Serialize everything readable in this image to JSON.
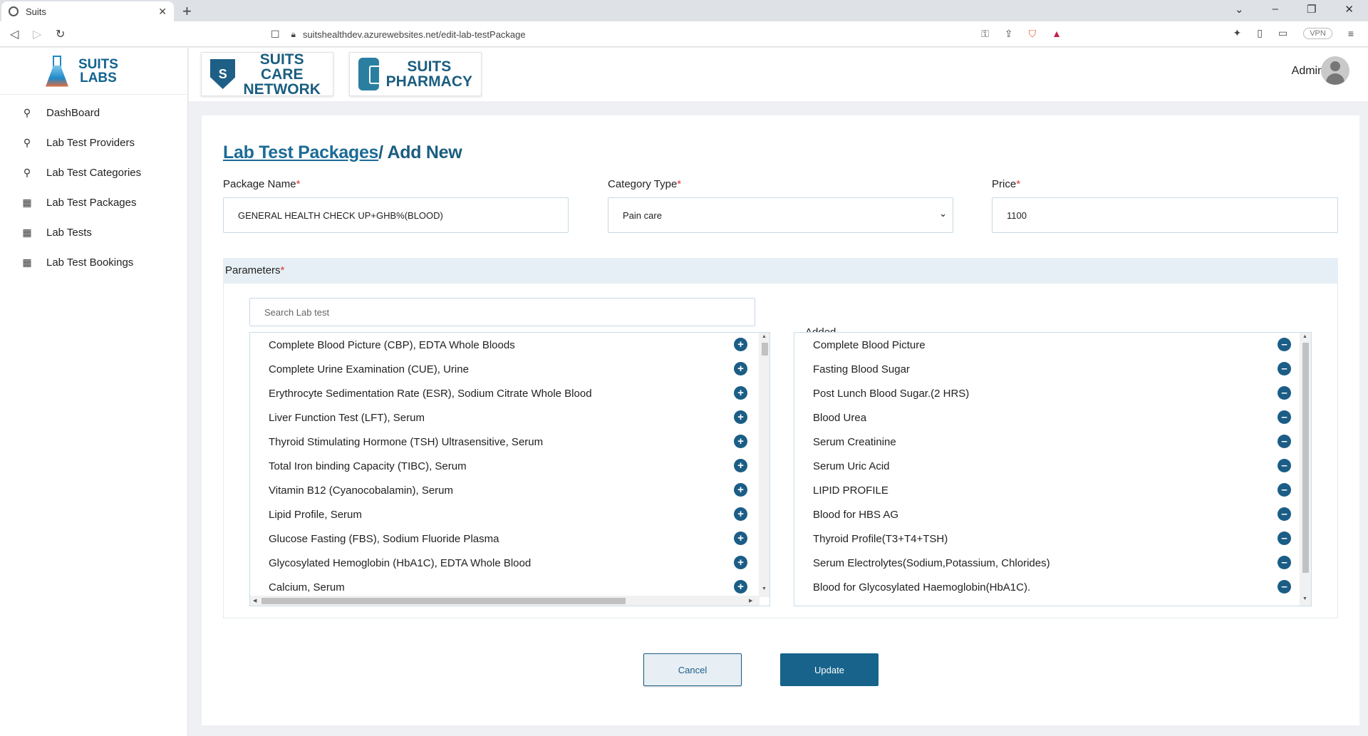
{
  "browser": {
    "tab_title": "Suits",
    "url": "suitshealthdev.azurewebsites.net/edit-lab-testPackage",
    "vpn": "VPN"
  },
  "logo": {
    "line1": "SUITS",
    "line2": "LABS"
  },
  "brands": [
    {
      "line1": "SUITS CARE",
      "line2": "NETWORK"
    },
    {
      "line1": "SUITS",
      "line2": "PHARMACY"
    }
  ],
  "user": {
    "name": "Admin"
  },
  "sidebar": {
    "items": [
      {
        "label": "DashBoard",
        "icon": "user-icon"
      },
      {
        "label": "Lab Test Providers",
        "icon": "user-icon"
      },
      {
        "label": "Lab Test Categories",
        "icon": "user-icon"
      },
      {
        "label": "Lab Test Packages",
        "icon": "calendar-icon"
      },
      {
        "label": "Lab Tests",
        "icon": "calendar-icon"
      },
      {
        "label": "Lab Test Bookings",
        "icon": "calendar-icon"
      }
    ]
  },
  "page": {
    "breadcrumb_link": "Lab Test Packages",
    "breadcrumb_current": "/ Add New"
  },
  "form": {
    "package_name": {
      "label": "Package Name",
      "value": "GENERAL HEALTH CHECK UP+GHB%(BLOOD)"
    },
    "category_type": {
      "label": "Category Type",
      "value": "Pain care"
    },
    "price": {
      "label": "Price",
      "value": "1100"
    },
    "required_mark": "*"
  },
  "parameters": {
    "label": "Parameters",
    "search_placeholder": "Search Lab test",
    "added_label": "Added",
    "available": [
      "Complete Blood Picture (CBP), EDTA Whole Bloods",
      "Complete Urine Examination (CUE), Urine",
      "Erythrocyte Sedimentation Rate (ESR), Sodium Citrate Whole Blood",
      "Liver Function Test (LFT), Serum",
      "Thyroid Stimulating Hormone (TSH) Ultrasensitive, Serum",
      "Total Iron binding Capacity (TIBC), Serum",
      "Vitamin B12 (Cyanocobalamin), Serum",
      "Lipid Profile, Serum",
      "Glucose Fasting (FBS), Sodium Fluoride Plasma",
      "Glycosylated Hemoglobin (HbA1C), EDTA Whole Blood",
      "Calcium, Serum"
    ],
    "added": [
      "Complete Blood Picture",
      "Fasting Blood Sugar",
      "Post Lunch Blood Sugar.(2 HRS)",
      "Blood Urea",
      "Serum Creatinine",
      "Serum Uric Acid",
      "LIPID PROFILE",
      "Blood for HBS AG",
      "Thyroid Profile(T3+T4+TSH)",
      "Serum Electrolytes(Sodium,Potassium, Chlorides)",
      "Blood for Glycosylated Haemoglobin(HbA1C)."
    ]
  },
  "buttons": {
    "cancel": "Cancel",
    "update": "Update"
  },
  "colors": {
    "primary": "#17638b",
    "accent_text": "#1b5e80",
    "header_bg": "#e6eff5"
  }
}
